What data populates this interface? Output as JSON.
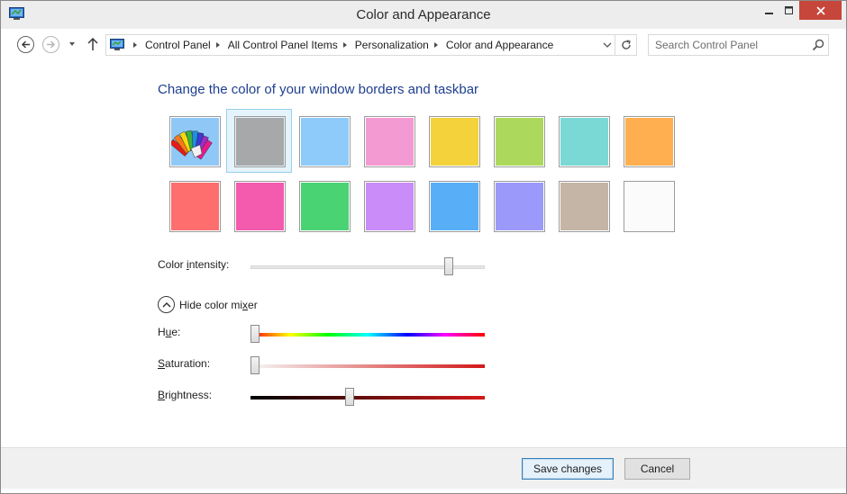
{
  "window": {
    "title": "Color and Appearance"
  },
  "nav": {
    "breadcrumbs": [
      "Control Panel",
      "All Control Panel Items",
      "Personalization",
      "Color and Appearance"
    ],
    "search_placeholder": "Search Control Panel"
  },
  "main": {
    "heading": "Change the color of your window borders and taskbar",
    "swatches": [
      {
        "color": "custom",
        "selected": false
      },
      {
        "color": "#a6a8aa",
        "selected": true
      },
      {
        "color": "#8ecbfb",
        "selected": false
      },
      {
        "color": "#f49ad3",
        "selected": false
      },
      {
        "color": "#f3d23b",
        "selected": false
      },
      {
        "color": "#acd95c",
        "selected": false
      },
      {
        "color": "#7ad8d5",
        "selected": false
      },
      {
        "color": "#ffaf50",
        "selected": false
      },
      {
        "color": "#ff6e6e",
        "selected": false
      },
      {
        "color": "#f45aad",
        "selected": false
      },
      {
        "color": "#4ad373",
        "selected": false
      },
      {
        "color": "#c98cf9",
        "selected": false
      },
      {
        "color": "#58aff8",
        "selected": false
      },
      {
        "color": "#9b9afa",
        "selected": false
      },
      {
        "color": "#c4b5a6",
        "selected": false
      },
      {
        "color": "#fbfbfb",
        "selected": false
      }
    ],
    "intensity": {
      "label_pre": "Color ",
      "label_key": "i",
      "label_post": "ntensity:",
      "value": 0.86
    },
    "mixer_toggle": {
      "label_pre": "Hide color mi",
      "label_key": "x",
      "label_post": "er"
    },
    "hue": {
      "label_pre": "H",
      "label_key": "u",
      "label_post": "e:",
      "value": 0.0
    },
    "saturation": {
      "label_pre": "",
      "label_key": "S",
      "label_post": "aturation:",
      "value": 0.0
    },
    "brightness": {
      "label_pre": "",
      "label_key": "B",
      "label_post": "rightness:",
      "value": 0.42
    }
  },
  "footer": {
    "save_label": "Save changes",
    "cancel_label": "Cancel"
  },
  "colors": {
    "heading": "#1e3f8f",
    "close_button": "#c7463b",
    "selection_bg": "#e5f3fb",
    "selection_border": "#99d1ef"
  }
}
